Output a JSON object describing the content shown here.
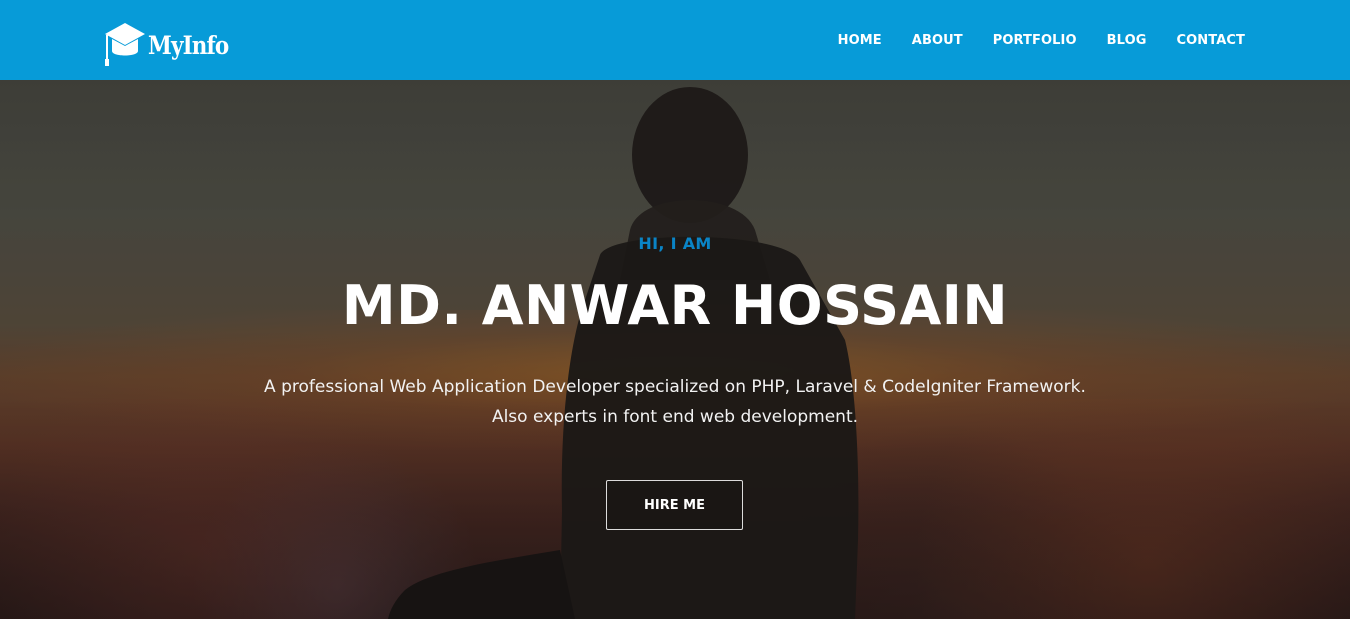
{
  "brand": {
    "name": "MyInfo",
    "icon": "graduation-cap-icon",
    "color": "#079bd8"
  },
  "nav": {
    "items": [
      {
        "label": "HOME"
      },
      {
        "label": "ABOUT"
      },
      {
        "label": "PORTFOLIO"
      },
      {
        "label": "BLOG"
      },
      {
        "label": "CONTACT"
      }
    ]
  },
  "hero": {
    "intro": "HI, I AM",
    "intro_color": "#0a84c6",
    "name": "MD. ANWAR HOSSAIN",
    "description_lines": [
      "A professional Web Application Developer specialized on PHP, Laravel & CodeIgniter Framework.",
      "Also experts in font end web development."
    ],
    "cta_label": "HIRE ME"
  }
}
